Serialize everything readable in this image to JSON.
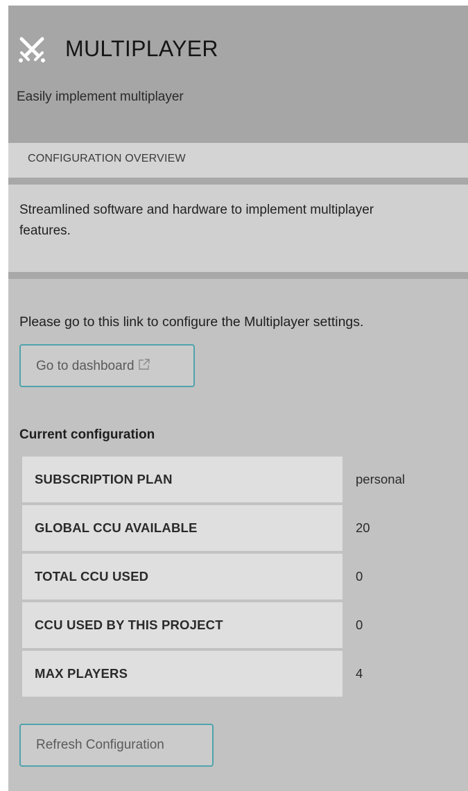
{
  "header": {
    "title": "MULTIPLAYER",
    "subtitle": "Easily implement multiplayer",
    "icon": "crossed-swords-icon"
  },
  "section": {
    "label": "CONFIGURATION OVERVIEW"
  },
  "description": {
    "text": "Streamlined software and hardware to implement multiplayer features."
  },
  "main": {
    "instruction": "Please go to this link to configure the Multiplayer settings.",
    "dashboard_button": "Go to dashboard",
    "dashboard_icon": "external-link-icon",
    "config_heading": "Current configuration",
    "config_rows": [
      {
        "key": "SUBSCRIPTION PLAN",
        "value": "personal"
      },
      {
        "key": "GLOBAL CCU AVAILABLE",
        "value": "20"
      },
      {
        "key": "TOTAL CCU USED",
        "value": "0"
      },
      {
        "key": "CCU USED BY THIS PROJECT",
        "value": "0"
      },
      {
        "key": "MAX PLAYERS",
        "value": "4"
      }
    ],
    "refresh_button": "Refresh Configuration"
  },
  "colors": {
    "panel_bg": "#c2c2c2",
    "header_bg": "#a6a6a6",
    "button_border": "#4fa3ac",
    "table_key_bg": "#dfdfdf"
  }
}
